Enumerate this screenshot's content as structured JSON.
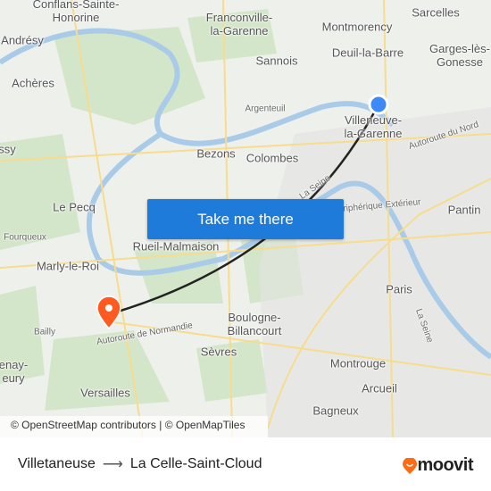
{
  "map": {
    "labels": [
      {
        "text": "Conflans-Sainte-\nHonorine",
        "cls": ""
      },
      {
        "text": "Andrésy",
        "cls": ""
      },
      {
        "text": "Achères",
        "cls": ""
      },
      {
        "text": "Franconville-\nla-Garenne",
        "cls": ""
      },
      {
        "text": "Montmorency",
        "cls": ""
      },
      {
        "text": "Sarcelles",
        "cls": ""
      },
      {
        "text": "Sannois",
        "cls": ""
      },
      {
        "text": "Deuil-la-Barre",
        "cls": ""
      },
      {
        "text": "Garges-lès-\nGonesse",
        "cls": ""
      },
      {
        "text": "Argenteuil",
        "cls": "sm"
      },
      {
        "text": "Villeneuve-\nla-Garenne",
        "cls": ""
      },
      {
        "text": "Bezons",
        "cls": ""
      },
      {
        "text": "Colombes",
        "cls": ""
      },
      {
        "text": "Autoroute du Nord",
        "cls": "sm"
      },
      {
        "text": "Le Pecq",
        "cls": ""
      },
      {
        "text": "Pantin",
        "cls": ""
      },
      {
        "text": "Fourqueux",
        "cls": "sm"
      },
      {
        "text": "Rueil-Malmaison",
        "cls": ""
      },
      {
        "text": "Marly-le-Roi",
        "cls": ""
      },
      {
        "text": "Paris",
        "cls": ""
      },
      {
        "text": "Boulogne-\nBillancourt",
        "cls": ""
      },
      {
        "text": "La Seine",
        "cls": "sm"
      },
      {
        "text": "Autoroute de Normandie",
        "cls": "sm"
      },
      {
        "text": "Bailly",
        "cls": "sm"
      },
      {
        "text": "Sèvres",
        "cls": ""
      },
      {
        "text": "Montrouge",
        "cls": ""
      },
      {
        "text": "enay-\neury",
        "cls": ""
      },
      {
        "text": "Arcueil",
        "cls": ""
      },
      {
        "text": "Versailles",
        "cls": ""
      },
      {
        "text": "Bagneux",
        "cls": ""
      },
      {
        "text": "ssy",
        "cls": ""
      },
      {
        "text": "Boulevard Périphérique Extérieur",
        "cls": "sm"
      },
      {
        "text": "La Seine",
        "cls": "sm"
      }
    ],
    "origin_color": "#3d8af7",
    "destination_color": "#ff5a1f",
    "route_color": "#222222"
  },
  "cta": {
    "label": "Take me there"
  },
  "attribution": "© OpenStreetMap contributors | © OpenMapTiles",
  "footer": {
    "origin": "Villetaneuse",
    "arrow": "⟶",
    "destination": "La Celle-Saint-Cloud"
  },
  "brand": {
    "name": "moovit",
    "color": "#ff6a13"
  }
}
